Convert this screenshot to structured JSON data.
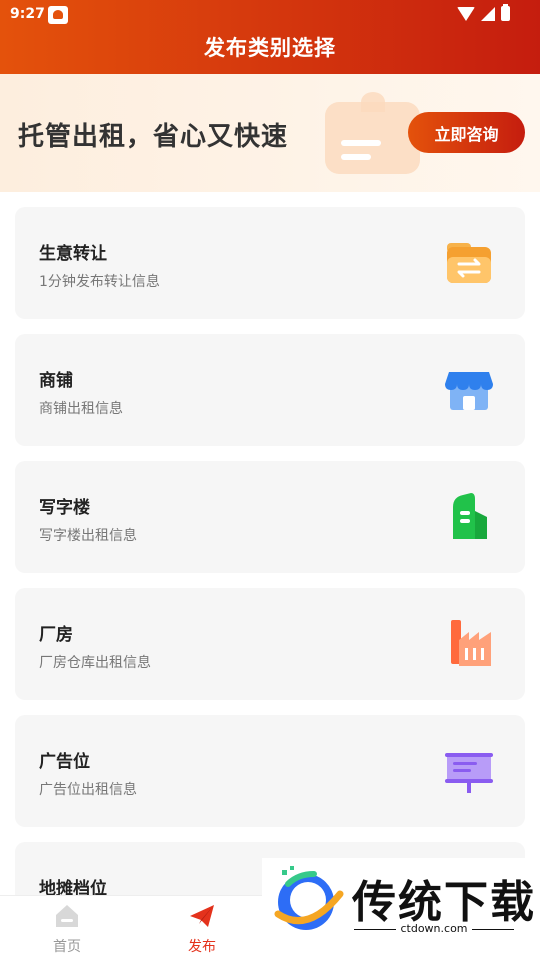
{
  "status_bar": {
    "time": "9:27"
  },
  "header": {
    "title": "发布类别选择"
  },
  "banner": {
    "slogan": "托管出租，省心又快速",
    "button_label": "立即咨询"
  },
  "categories": [
    {
      "name": "生意转让",
      "desc": "1分钟发布转让信息",
      "icon": "transfer-folder-icon",
      "color": "#f5a030"
    },
    {
      "name": "商铺",
      "desc": "商铺出租信息",
      "icon": "storefront-icon",
      "color": "#2f80ed"
    },
    {
      "name": "写字楼",
      "desc": "写字楼出租信息",
      "icon": "office-building-icon",
      "color": "#21c24a"
    },
    {
      "name": "厂房",
      "desc": "厂房仓库出租信息",
      "icon": "factory-icon",
      "color": "#ff6a3d"
    },
    {
      "name": "广告位",
      "desc": "广告位出租信息",
      "icon": "billboard-icon",
      "color": "#8a5cf0"
    },
    {
      "name": "地摊档位",
      "desc": "",
      "icon": "",
      "color": ""
    }
  ],
  "tabbar": {
    "tabs": [
      {
        "label": "首页",
        "icon": "home-icon",
        "active": false
      },
      {
        "label": "发布",
        "icon": "paper-plane-icon",
        "active": true
      }
    ],
    "active_color": "#e4321c",
    "inactive_color": "#999999"
  },
  "watermark": {
    "text": "传统下载",
    "url": "ctdown.com"
  }
}
